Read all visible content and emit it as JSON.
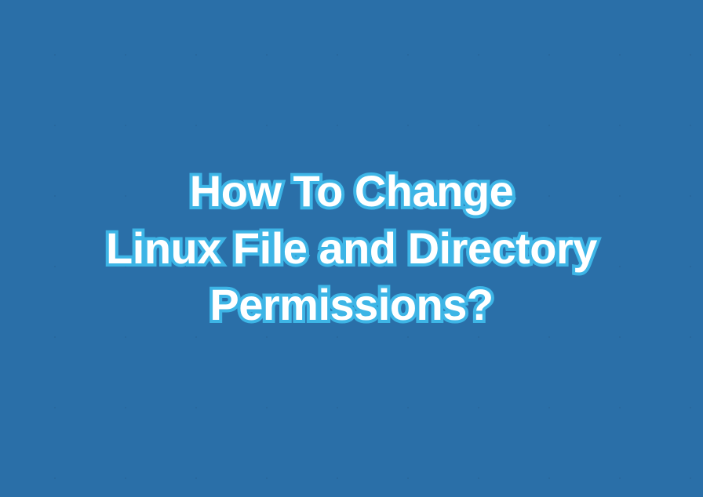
{
  "title": {
    "line1": "How To Change",
    "line2": "Linux File and Directory",
    "line3": "Permissions?"
  },
  "colors": {
    "background": "#2a6fa8",
    "text": "#ffffff",
    "outline": "#3db5e6",
    "gridLines": "rgba(0,0,0,0.08)"
  }
}
